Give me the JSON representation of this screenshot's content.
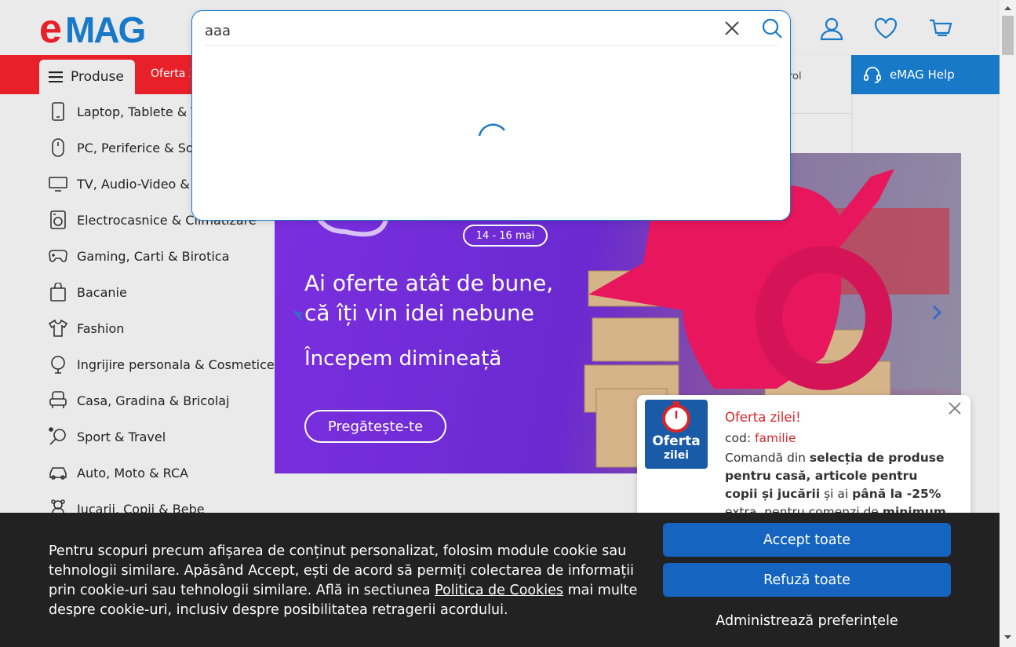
{
  "header": {
    "logo": "eMAG",
    "nav_products": "Produse",
    "nav_offer_partial": "Oferta Z",
    "account_partial": "rol",
    "help": "eMAG Help"
  },
  "search": {
    "value": "aaa"
  },
  "categories": [
    {
      "label": "Laptop, Tablete & T",
      "icon": "phone-icon"
    },
    {
      "label": "PC, Periferice & Sof",
      "icon": "mouse-icon"
    },
    {
      "label": "TV, Audio-Video & F",
      "icon": "tv-icon"
    },
    {
      "label": "Electrocasnice & Climatizare",
      "icon": "washing-machine-icon"
    },
    {
      "label": "Gaming, Carti & Birotica",
      "icon": "gamepad-icon"
    },
    {
      "label": "Bacanie",
      "icon": "bag-icon"
    },
    {
      "label": "Fashion",
      "icon": "tshirt-icon"
    },
    {
      "label": "Ingrijire personala & Cosmetice",
      "icon": "mirror-icon"
    },
    {
      "label": "Casa, Gradina & Bricolaj",
      "icon": "armchair-icon"
    },
    {
      "label": "Sport & Travel",
      "icon": "racket-icon"
    },
    {
      "label": "Auto, Moto & RCA",
      "icon": "car-icon"
    },
    {
      "label": "Jucarii, Copii & Bebe",
      "icon": "teddy-icon"
    }
  ],
  "banner": {
    "date": "14 - 16 mai",
    "headline_1": "Ai oferte atât de bune,",
    "headline_2": "că îți vin idei nebune",
    "subline": "Începem dimineață",
    "cta": "Pregătește-te"
  },
  "promo": {
    "badge_line1": "Oferta",
    "badge_line2": "zilei",
    "title": "Oferta zilei!",
    "code_label": "cod:",
    "code_value": "familie",
    "text_1": "Comandă din",
    "bold_1": "selecția de produse pentru casă, articole pentru copii și jucării",
    "text_2": "și ai",
    "bold_2": "până la -25%",
    "text_3": "extra, pentru comenzi de",
    "bold_3": "minimum"
  },
  "cookie": {
    "text_before": "Pentru scopuri precum afișarea de conținut personalizat, folosim module cookie sau tehnologii similare. Apăsând Accept, ești de acord să permiți colectarea de informații prin cookie-uri sau tehnologii similare. Află in sectiunea ",
    "link": "Politica de Cookies",
    "text_after": " mai multe despre cookie-uri, inclusiv despre posibilitatea retragerii acordului.",
    "accept": "Accept toate",
    "refuse": "Refuză toate",
    "manage": "Administrează preferințele"
  },
  "colors": {
    "brand_red": "#e8202a",
    "brand_blue": "#1979c9",
    "button_blue": "#1565c0",
    "promo_red": "#d7262b"
  }
}
